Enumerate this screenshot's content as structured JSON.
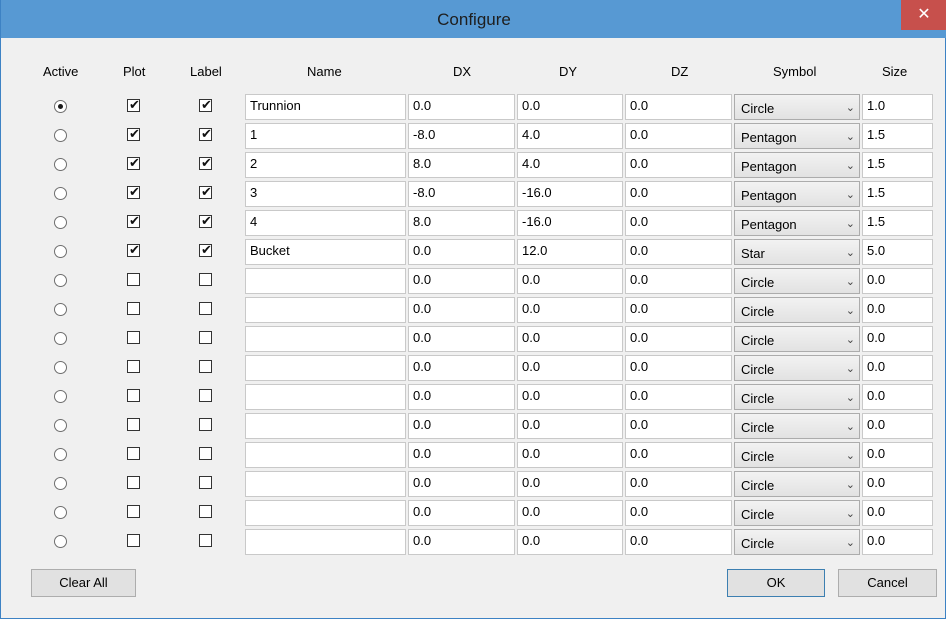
{
  "window": {
    "title": "Configure",
    "close_icon": "close-icon"
  },
  "headers": {
    "active": "Active",
    "plot": "Plot",
    "label": "Label",
    "name": "Name",
    "dx": "DX",
    "dy": "DY",
    "dz": "DZ",
    "symbol": "Symbol",
    "size": "Size"
  },
  "rows": [
    {
      "active": true,
      "plot": true,
      "label": true,
      "name": "Trunnion",
      "dx": "0.0",
      "dy": "0.0",
      "dz": "0.0",
      "symbol": "Circle",
      "size": "1.0"
    },
    {
      "active": false,
      "plot": true,
      "label": true,
      "name": "1",
      "dx": "-8.0",
      "dy": "4.0",
      "dz": "0.0",
      "symbol": "Pentagon",
      "size": "1.5"
    },
    {
      "active": false,
      "plot": true,
      "label": true,
      "name": "2",
      "dx": "8.0",
      "dy": "4.0",
      "dz": "0.0",
      "symbol": "Pentagon",
      "size": "1.5"
    },
    {
      "active": false,
      "plot": true,
      "label": true,
      "name": "3",
      "dx": "-8.0",
      "dy": "-16.0",
      "dz": "0.0",
      "symbol": "Pentagon",
      "size": "1.5"
    },
    {
      "active": false,
      "plot": true,
      "label": true,
      "name": "4",
      "dx": "8.0",
      "dy": "-16.0",
      "dz": "0.0",
      "symbol": "Pentagon",
      "size": "1.5"
    },
    {
      "active": false,
      "plot": true,
      "label": true,
      "name": "Bucket",
      "dx": "0.0",
      "dy": "12.0",
      "dz": "0.0",
      "symbol": "Star",
      "size": "5.0"
    },
    {
      "active": false,
      "plot": false,
      "label": false,
      "name": "",
      "dx": "0.0",
      "dy": "0.0",
      "dz": "0.0",
      "symbol": "Circle",
      "size": "0.0"
    },
    {
      "active": false,
      "plot": false,
      "label": false,
      "name": "",
      "dx": "0.0",
      "dy": "0.0",
      "dz": "0.0",
      "symbol": "Circle",
      "size": "0.0"
    },
    {
      "active": false,
      "plot": false,
      "label": false,
      "name": "",
      "dx": "0.0",
      "dy": "0.0",
      "dz": "0.0",
      "symbol": "Circle",
      "size": "0.0"
    },
    {
      "active": false,
      "plot": false,
      "label": false,
      "name": "",
      "dx": "0.0",
      "dy": "0.0",
      "dz": "0.0",
      "symbol": "Circle",
      "size": "0.0"
    },
    {
      "active": false,
      "plot": false,
      "label": false,
      "name": "",
      "dx": "0.0",
      "dy": "0.0",
      "dz": "0.0",
      "symbol": "Circle",
      "size": "0.0"
    },
    {
      "active": false,
      "plot": false,
      "label": false,
      "name": "",
      "dx": "0.0",
      "dy": "0.0",
      "dz": "0.0",
      "symbol": "Circle",
      "size": "0.0"
    },
    {
      "active": false,
      "plot": false,
      "label": false,
      "name": "",
      "dx": "0.0",
      "dy": "0.0",
      "dz": "0.0",
      "symbol": "Circle",
      "size": "0.0"
    },
    {
      "active": false,
      "plot": false,
      "label": false,
      "name": "",
      "dx": "0.0",
      "dy": "0.0",
      "dz": "0.0",
      "symbol": "Circle",
      "size": "0.0"
    },
    {
      "active": false,
      "plot": false,
      "label": false,
      "name": "",
      "dx": "0.0",
      "dy": "0.0",
      "dz": "0.0",
      "symbol": "Circle",
      "size": "0.0"
    },
    {
      "active": false,
      "plot": false,
      "label": false,
      "name": "",
      "dx": "0.0",
      "dy": "0.0",
      "dz": "0.0",
      "symbol": "Circle",
      "size": "0.0"
    }
  ],
  "buttons": {
    "clear_all": "Clear All",
    "ok": "OK",
    "cancel": "Cancel"
  },
  "colors": {
    "titlebar": "#5799d3",
    "close": "#c7504c",
    "dialog_bg": "#f0f0f0"
  }
}
